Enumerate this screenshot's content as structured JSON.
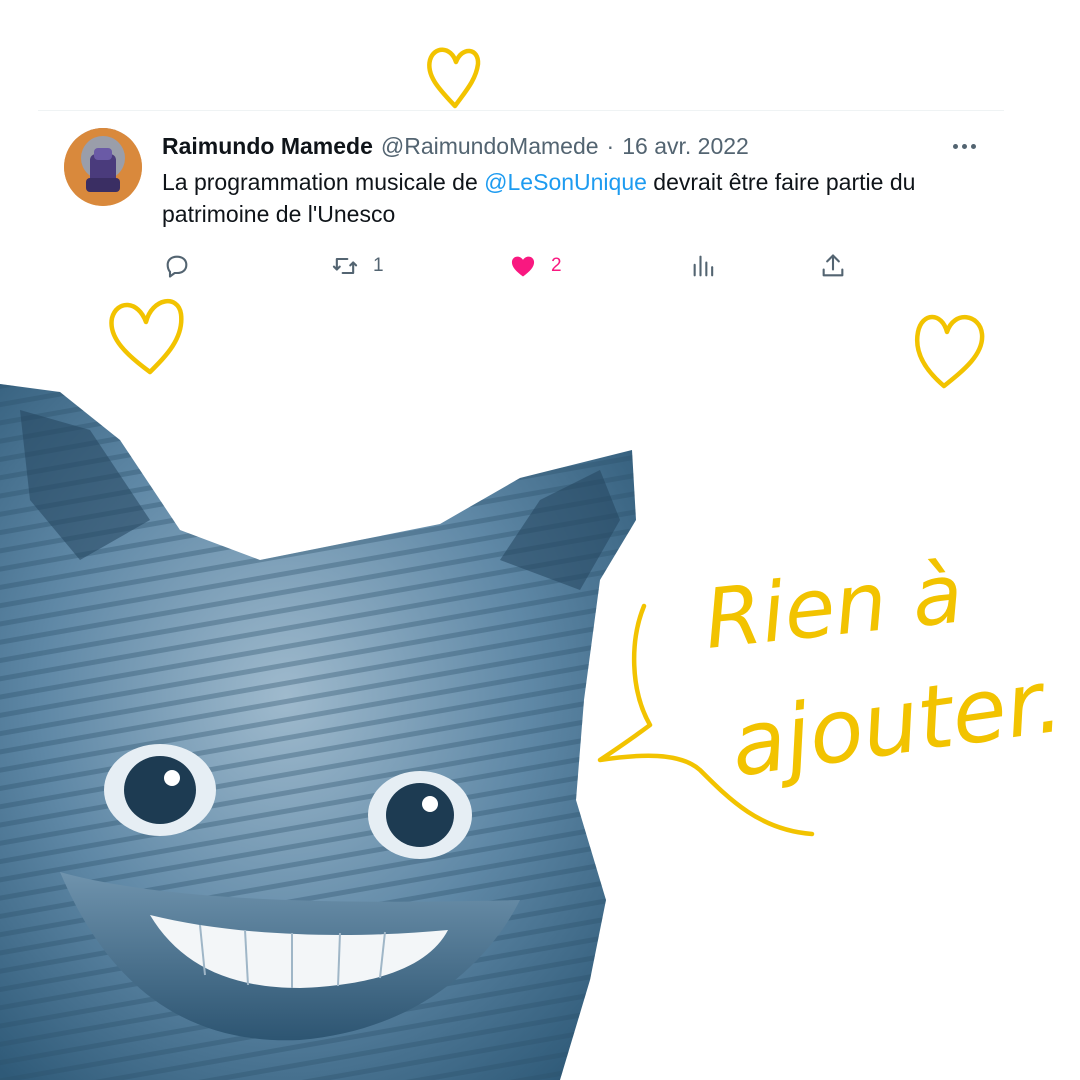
{
  "tweet": {
    "author_name": "Raimundo Mamede",
    "handle": "@RaimundoMamede",
    "separator": "·",
    "date": "16 avr. 2022",
    "text_before": "La programmation musicale de ",
    "mention": "@LeSonUnique",
    "text_after": " devrait être faire partie du patrimoine de l'Unesco",
    "actions": {
      "reply_icon": "reply-bubble-icon",
      "retweet_icon": "retweet-icon",
      "retweet_count": "1",
      "like_icon": "heart-filled-icon",
      "like_count": "2",
      "views_icon": "views-bar-chart-icon",
      "share_icon": "share-upload-icon"
    },
    "more_icon": "more-dots-icon"
  },
  "overlay": {
    "speech_text_line1": "Rien à",
    "speech_text_line2": "ajouter.",
    "doodle_icon": "heart-outline-icon",
    "image_subject": "grinning-cat-image"
  },
  "colors": {
    "accent_yellow": "#f2c300",
    "cat_blue": "#3f6f90",
    "like_pink": "#f91880",
    "mention_blue": "#1d9bf0",
    "text_dark": "#0f1419",
    "text_grey": "#536471"
  }
}
